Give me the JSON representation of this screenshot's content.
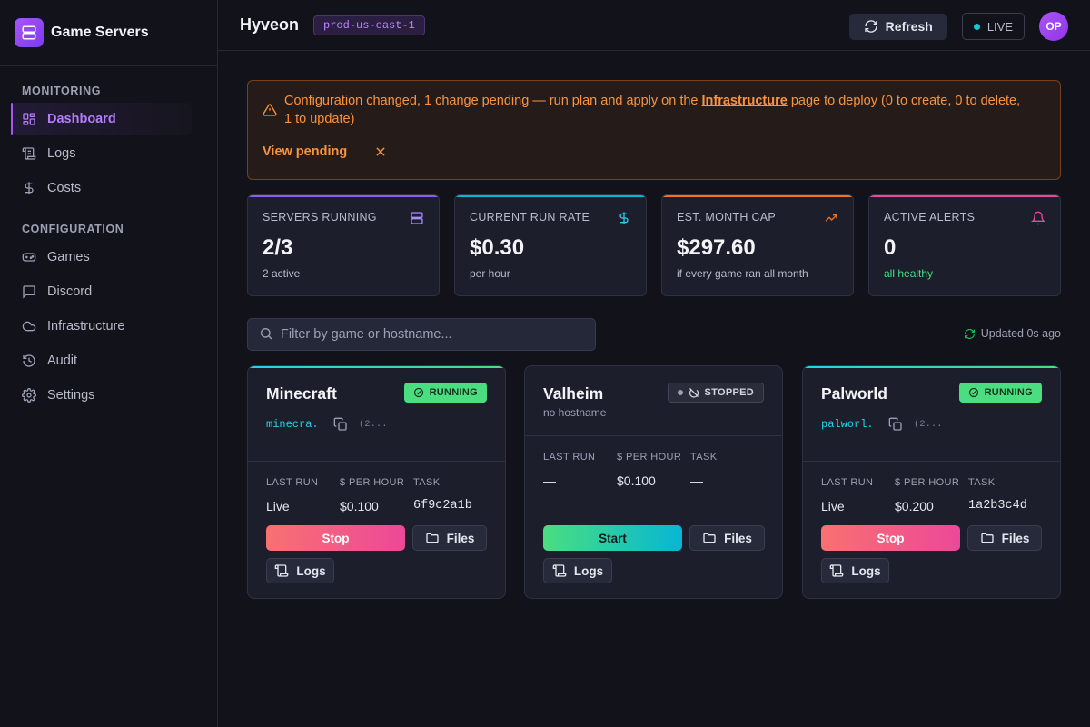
{
  "app": {
    "name": "Game Servers",
    "logo_icon": "server-icon"
  },
  "sidebar": {
    "sections": [
      {
        "heading": "MONITORING",
        "items": [
          {
            "label": "Dashboard",
            "icon": "dashboard-icon",
            "active": true
          },
          {
            "label": "Logs",
            "icon": "scroll-icon"
          },
          {
            "label": "Costs",
            "icon": "dollar-icon"
          }
        ]
      },
      {
        "heading": "CONFIGURATION",
        "items": [
          {
            "label": "Games",
            "icon": "gamepad-icon"
          },
          {
            "label": "Discord",
            "icon": "chat-icon"
          },
          {
            "label": "Infrastructure",
            "icon": "cloud-icon"
          },
          {
            "label": "Audit",
            "icon": "history-icon"
          },
          {
            "label": "Settings",
            "icon": "gear-icon"
          }
        ]
      }
    ]
  },
  "header": {
    "title": "Hyveon",
    "env": "prod-us-east-1",
    "refresh_label": "Refresh",
    "live_label": "LIVE",
    "avatar_initials": "OP"
  },
  "alert": {
    "text_before": "Configuration changed, 1 change pending — run plan and apply on the ",
    "link_text": "Infrastructure",
    "text_after": " page to deploy (0 to create, 0 to delete, 1 to update)",
    "view_label": "View pending"
  },
  "stats": [
    {
      "label": "SERVERS RUNNING",
      "value": "2/3",
      "sub": "2 active",
      "icon": "server-icon",
      "color": "#8b5cf6"
    },
    {
      "label": "CURRENT RUN RATE",
      "value": "$0.30",
      "sub": "per hour",
      "icon": "dollar-icon",
      "color": "#06b6d4"
    },
    {
      "label": "EST. MONTH CAP",
      "value": "$297.60",
      "sub": "if every game ran all month",
      "icon": "trending-up-icon",
      "color": "#f97316"
    },
    {
      "label": "ACTIVE ALERTS",
      "value": "0",
      "sub": "all healthy",
      "icon": "bell-icon",
      "color": "#ec4899"
    }
  ],
  "filter": {
    "placeholder": "Filter by game or hostname..."
  },
  "updated_text": "Updated 0s ago",
  "meta_labels": {
    "last_run": "LAST RUN",
    "per_hour": "$ PER HOUR",
    "task": "TASK"
  },
  "servers": [
    {
      "name": "Minecraft",
      "status": "RUNNING",
      "host": "minecra...",
      "ip": "(2...",
      "last_run": "Live",
      "per_hour": "$0.100",
      "task": "6f9c2a1b",
      "primary_action": "Stop",
      "files_label": "Files",
      "logs_label": "Logs"
    },
    {
      "name": "Valheim",
      "status": "STOPPED",
      "host_note": "no hostname",
      "last_run": "—",
      "per_hour": "$0.100",
      "task": "—",
      "primary_action": "Start",
      "files_label": "Files",
      "logs_label": "Logs"
    },
    {
      "name": "Palworld",
      "status": "RUNNING",
      "host": "palworl...",
      "ip": "(2...",
      "last_run": "Live",
      "per_hour": "$0.200",
      "task": "1a2b3c4d",
      "primary_action": "Stop",
      "files_label": "Files",
      "logs_label": "Logs"
    }
  ],
  "colors": {
    "accent": "#a855f7",
    "running": "#4ade80",
    "warning": "#fb923c",
    "link": "#22d3ee"
  }
}
